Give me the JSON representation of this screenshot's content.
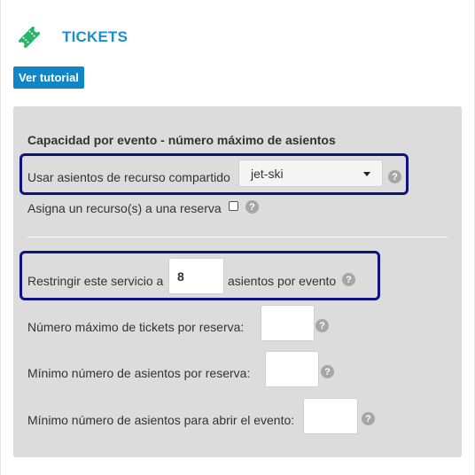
{
  "header": {
    "title": "TICKETS",
    "icon": "ticket-icon",
    "icon_color": "#2bb36a",
    "title_color": "#1a8fc9"
  },
  "tutorial_button": {
    "label": "Ver tutorial",
    "color": "#1086c6"
  },
  "panel": {
    "section_title": "Capacidad por evento - número máximo de asientos",
    "shared_resource": {
      "label": "Usar asientos de recurso compartido",
      "selected": "jet-ski"
    },
    "assign_resource": {
      "label": "Asigna un recurso(s) a una reserva",
      "checked": false
    },
    "restrict": {
      "prefix": "Restringir este servicio a",
      "value": "8",
      "suffix": "asientos por evento"
    },
    "max_tickets": {
      "label": "Número máximo de tickets por reserva:",
      "value": ""
    },
    "min_seats": {
      "label": "Mínimo número de asientos por reserva:",
      "value": ""
    },
    "min_open": {
      "label": "Mínimo número de asientos para abrir el evento:",
      "value": ""
    },
    "help_glyph": "?",
    "highlight_color": "#0d1480"
  }
}
